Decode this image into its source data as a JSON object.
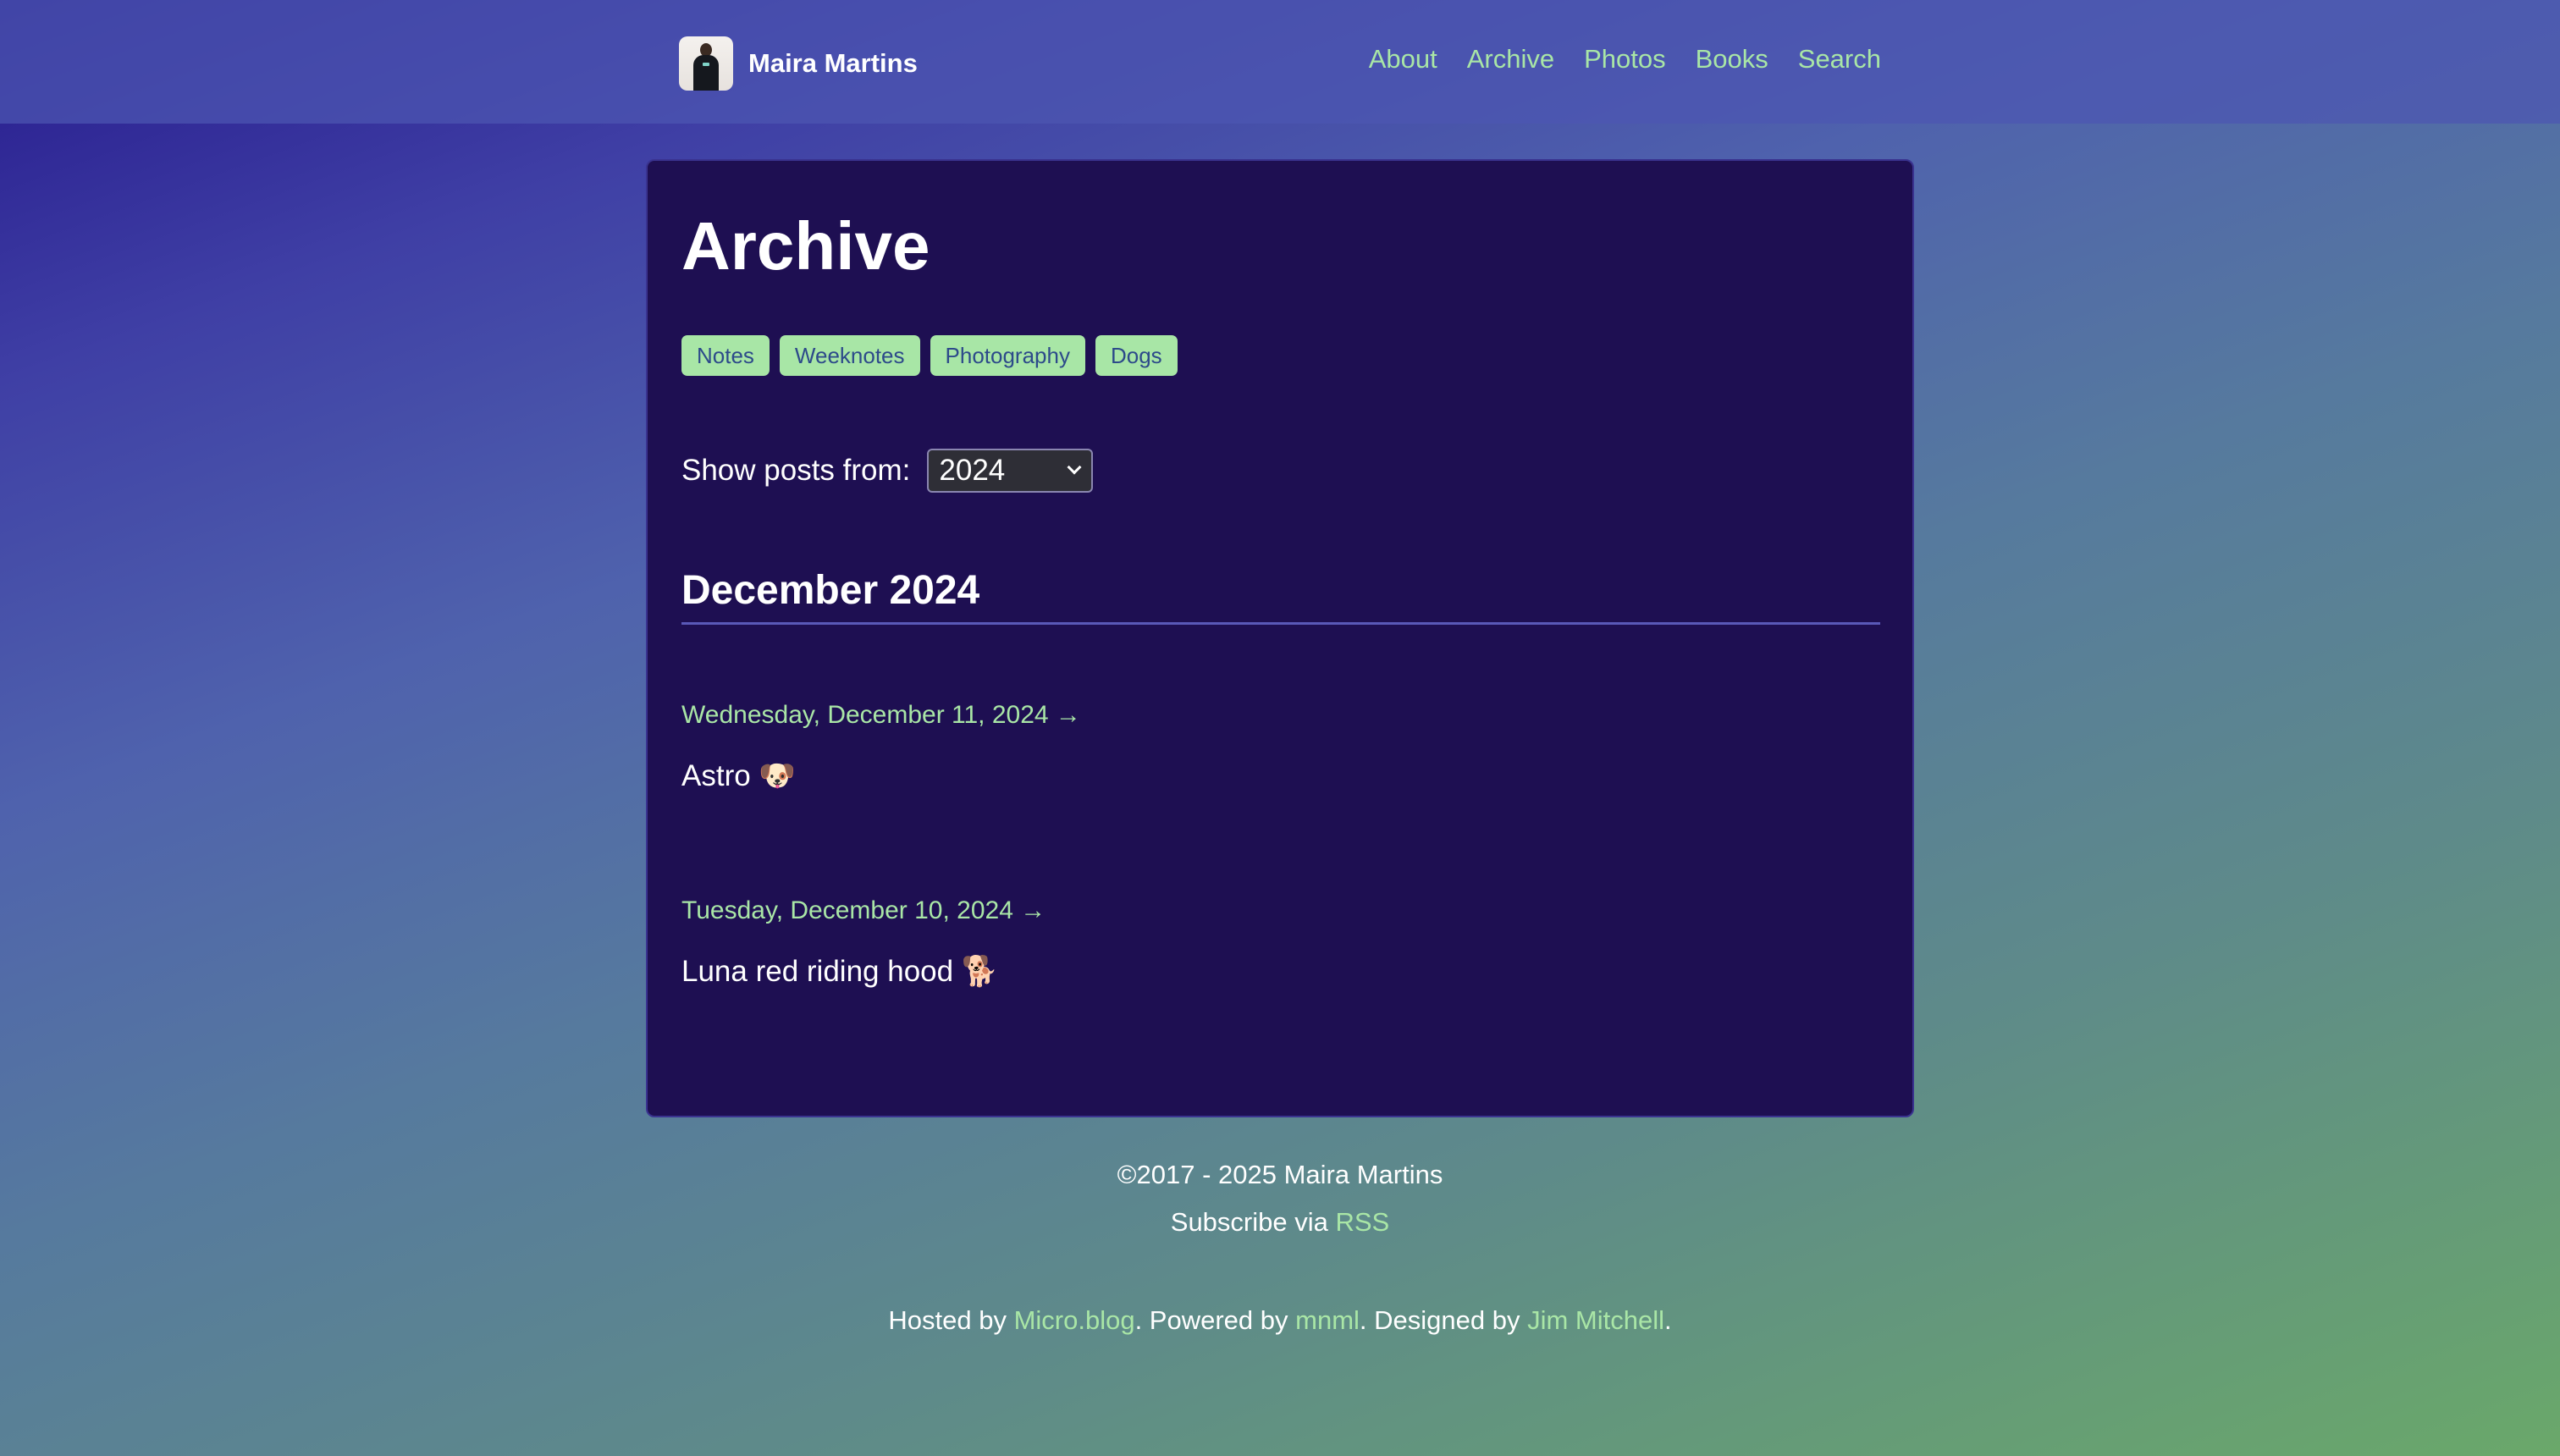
{
  "header": {
    "site_name": "Maira Martins",
    "nav": [
      "About",
      "Archive",
      "Photos",
      "Books",
      "Search"
    ]
  },
  "main": {
    "title": "Archive",
    "tags": [
      "Notes",
      "Weeknotes",
      "Photography",
      "Dogs"
    ],
    "filter": {
      "label": "Show posts from:",
      "selected_year": "2024"
    },
    "month_heading": "December 2024",
    "posts": [
      {
        "date": "Wednesday, December 11, 2024 →",
        "text": "Astro 🐶"
      },
      {
        "date": "Tuesday, December 10, 2024 →",
        "text": "Luna red riding hood 🐕"
      }
    ]
  },
  "footer": {
    "copyright": "©2017 - 2025 Maira Martins",
    "subscribe_prefix": "Subscribe via ",
    "rss_label": "RSS",
    "hosted_prefix": "Hosted by ",
    "host_link": "Micro.blog",
    "powered_prefix": ". Powered by ",
    "powered_link": "mnml",
    "designed_prefix": ". Designed by ",
    "designer_link": "Jim Mitchell",
    "end": "."
  },
  "colors": {
    "accent": "#a9e6a6",
    "card_bg": "#1e0f52",
    "tag_bg": "#a8e6a6"
  }
}
